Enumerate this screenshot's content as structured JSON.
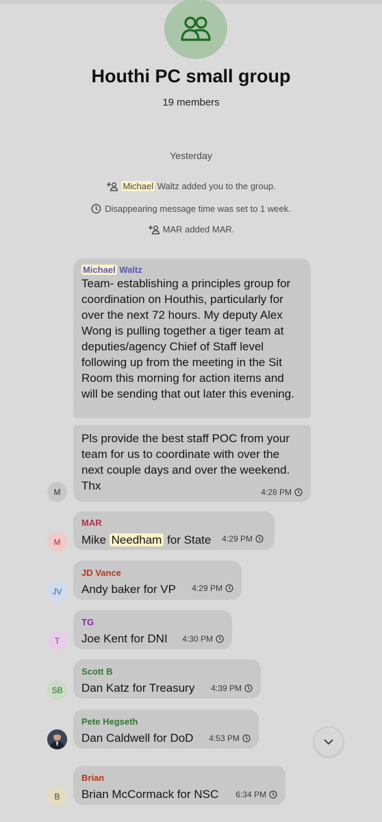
{
  "header": {
    "group_name": "Houthi PC small group",
    "member_count": "19 members"
  },
  "date_separator": "Yesterday",
  "system_messages": {
    "added_you_name": "Michael",
    "added_you_rest": " Waltz added you to the group.",
    "disappearing": "Disappearing message time was set to 1 week.",
    "mar_added": "MAR added MAR."
  },
  "messages": {
    "waltz": {
      "sender_first": "Michael",
      "sender_last": " Waltz",
      "part1": "Team- establishing a principles group for coordination on Houthis, particularly for over the next 72 hours. My deputy Alex Wong is pulling together a tiger team at deputies/agency Chief of Staff level following up from the meeting in the Sit Room this morning for action items and will be sending that out later this evening.",
      "part2": "Pls provide the best staff POC from your team for us to coordinate with over the next couple days and over the weekend. Thx",
      "time": "4:28 PM",
      "avatar": "M"
    },
    "mar": {
      "sender": "MAR",
      "text_before": "Mike ",
      "text_highlight": "Needham",
      "text_after": " for State",
      "time": "4:29 PM",
      "avatar": "M"
    },
    "vance": {
      "sender": "JD Vance",
      "text": "Andy baker for VP",
      "time": "4:29 PM",
      "avatar": "JV"
    },
    "tg": {
      "sender": "TG",
      "text": "Joe Kent for DNI",
      "time": "4:30 PM",
      "avatar": "T"
    },
    "scott": {
      "sender": "Scott B",
      "text": "Dan Katz for Treasury",
      "time": "4:39 PM",
      "avatar": "SB"
    },
    "hegseth": {
      "sender": "Pete Hegseth",
      "text": "Dan Caldwell for DoD",
      "time": "4:53 PM"
    },
    "brian": {
      "sender": "Brian",
      "text": "Brian McCormack for NSC",
      "time": "6:34 PM",
      "avatar": "B"
    }
  },
  "colors": {
    "waltz_name": "#5b56b5",
    "mar_name": "#b0304a",
    "vance_name": "#b2381f",
    "tg_name": "#8d2aa6",
    "scott_name": "#2e7a2e",
    "hegseth_name": "#2e7a2e",
    "brian_name": "#b2381f",
    "group_icon": "#1f6b23"
  },
  "icons": [
    "group-icon",
    "add-person-icon",
    "timer-icon",
    "clock-icon",
    "chevron-down-icon"
  ]
}
